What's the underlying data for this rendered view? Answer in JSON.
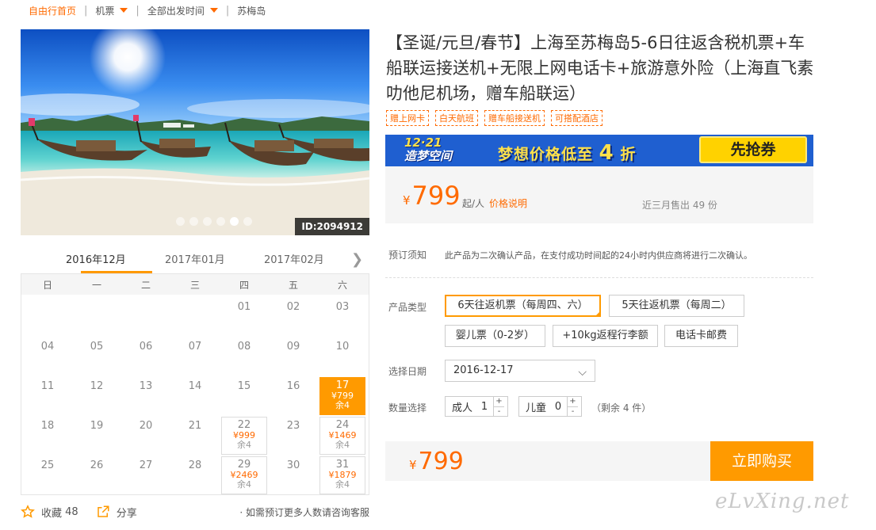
{
  "breadcrumb": {
    "home": "自由行首页",
    "items": [
      "机票",
      "全部出发时间",
      "苏梅岛"
    ]
  },
  "gallery": {
    "id_label": "ID:2094912",
    "dot_count": 6,
    "active_dot": 4
  },
  "calendar": {
    "months": [
      "2016年12月",
      "2017年01月",
      "2017年02月"
    ],
    "active_month": 0,
    "weekdays": [
      "日",
      "一",
      "二",
      "三",
      "四",
      "五",
      "六"
    ],
    "rows": [
      [
        {
          "d": ""
        },
        {
          "d": ""
        },
        {
          "d": ""
        },
        {
          "d": ""
        },
        {
          "d": "01"
        },
        {
          "d": "02"
        },
        {
          "d": "03"
        }
      ],
      [
        {
          "d": "04"
        },
        {
          "d": "05"
        },
        {
          "d": "06"
        },
        {
          "d": "07"
        },
        {
          "d": "08"
        },
        {
          "d": "09"
        },
        {
          "d": "10"
        }
      ],
      [
        {
          "d": "11"
        },
        {
          "d": "12"
        },
        {
          "d": "13"
        },
        {
          "d": "14"
        },
        {
          "d": "15"
        },
        {
          "d": "16"
        },
        {
          "d": "17",
          "p": "¥799",
          "r": "余4",
          "sel": true
        }
      ],
      [
        {
          "d": "18"
        },
        {
          "d": "19"
        },
        {
          "d": "20"
        },
        {
          "d": "21"
        },
        {
          "d": "22",
          "p": "¥999",
          "r": "余4"
        },
        {
          "d": "23"
        },
        {
          "d": "24",
          "p": "¥1469",
          "r": "余4"
        }
      ],
      [
        {
          "d": "25"
        },
        {
          "d": "26"
        },
        {
          "d": "27"
        },
        {
          "d": "28"
        },
        {
          "d": "29",
          "p": "¥2469",
          "r": "余4"
        },
        {
          "d": "30"
        },
        {
          "d": "31",
          "p": "¥1879",
          "r": "余4"
        }
      ]
    ]
  },
  "actions": {
    "favorite_label": "收藏",
    "favorite_count": "48",
    "share_label": "分享",
    "note": "· 如需预订更多人数请咨询客服"
  },
  "product": {
    "title": "【圣诞/元旦/春节】上海至苏梅岛5-6日往返含税机票+车船联运接送机+无限上网电话卡+旅游意外险（上海直飞素叻他尼机场，赠车船联运）",
    "tags": [
      "赠上网卡",
      "白天航班",
      "赠车船接送机",
      "可搭配酒店"
    ]
  },
  "banner": {
    "logo_line1": "12·21",
    "logo_line2": "造梦空间",
    "text_pre": "梦想价格低至",
    "text_big": "4",
    "text_post": "折",
    "button": "先抢券"
  },
  "price": {
    "currency": "¥",
    "amount": "799",
    "unit": "起/人",
    "link": "价格说明",
    "sold": "近三月售出 49 份"
  },
  "notice": {
    "label": "预订须知",
    "text": "此产品为二次确认产品，在支付成功时间起的24小时内供应商将进行二次确认。"
  },
  "options": {
    "label": "产品类型",
    "items": [
      "6天往返机票（每周四、六）",
      "5天往返机票（每周二）",
      "婴儿票（0-2岁）",
      "+10kg返程行李额",
      "电话卡邮费"
    ],
    "selected": 0
  },
  "date": {
    "label": "选择日期",
    "value": "2016-12-17"
  },
  "quantity": {
    "label": "数量选择",
    "adult_label": "成人",
    "adult_value": "1",
    "child_label": "儿童",
    "child_value": "0",
    "plus": "+",
    "minus": "-",
    "remain": "（剩余 4 件）"
  },
  "buy": {
    "currency": "¥",
    "amount": "799",
    "button": "立即购买"
  },
  "watermark": "eLvXing.net",
  "colors": {
    "accent": "#ff6a00",
    "button": "#ff9a00",
    "banner": "#1f5fd0"
  }
}
